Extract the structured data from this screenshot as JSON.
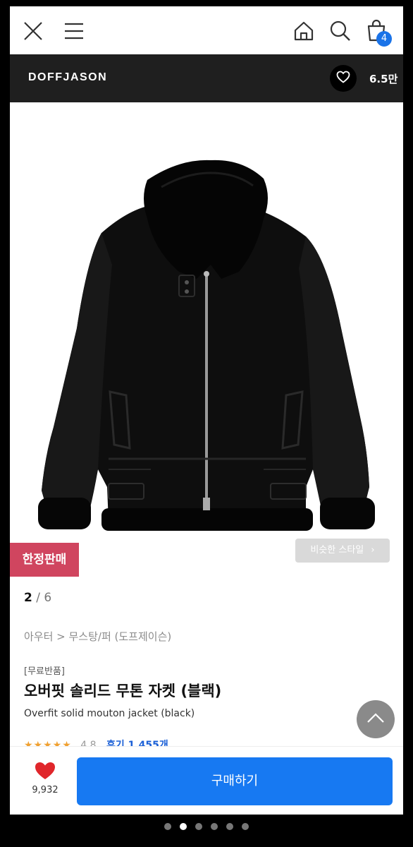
{
  "topbar": {
    "close_icon": "close-icon",
    "menu_icon": "menu-icon",
    "home_icon": "home-icon",
    "search_icon": "search-icon",
    "cart_icon": "cart-icon",
    "cart_count": "4"
  },
  "brand": {
    "name": "DOFFJASON",
    "likes": "6.5만",
    "heart_icon": "heart-outline-icon"
  },
  "product": {
    "limited_label": "한정판매",
    "similar_style_label": "비슷한 스타일",
    "image_current": "2",
    "image_separator": "/",
    "image_total": "6",
    "breadcrumb": "아우터 > 무스탕/퍼 (도프제이슨)",
    "tag": "[무료반품]",
    "title_ko": "오버핏 솔리드 무톤 자켓 (블랙)",
    "title_en": "Overfit solid mouton jacket (black)",
    "stars": "★★★★★",
    "rating": "4.8",
    "reviews": "후기 1,455개"
  },
  "bottom": {
    "wish_count": "9,932",
    "buy_label": "구매하기"
  },
  "colors": {
    "accent_blue": "#1779f2",
    "limited_red": "#d0455f",
    "brand_bar": "#1f1f1f",
    "heart_red": "#e0262b"
  },
  "pager_dots": {
    "count": 6,
    "active_index": 1
  }
}
